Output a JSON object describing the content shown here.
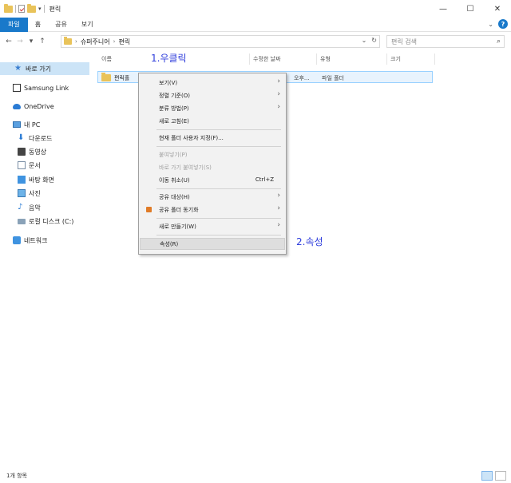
{
  "window": {
    "title": "편릭",
    "qa_dropdown": "▾",
    "controls": {
      "minimize": "—",
      "maximize": "☐",
      "close": "✕"
    }
  },
  "ribbon": {
    "tabs": [
      "파일",
      "홈",
      "공유",
      "보기"
    ],
    "expand_glyph": "⌄",
    "help_glyph": "?"
  },
  "nav": {
    "back": "←",
    "forward": "→",
    "recent": "▾",
    "up": "↑",
    "breadcrumb": [
      "슈퍼주니어",
      "편릭"
    ],
    "crumb_sep": "›",
    "dropdown": "⌄",
    "refresh": "↻",
    "search_placeholder": "편릭 검색",
    "search_glyph": "⌕"
  },
  "sidebar": {
    "items": [
      {
        "label": "바로 가기",
        "icon": "star-icon"
      },
      {
        "label": "Samsung Link",
        "icon": "samsung-link-icon"
      },
      {
        "label": "OneDrive",
        "icon": "cloud-icon"
      },
      {
        "label": "내 PC",
        "icon": "pc-icon"
      },
      {
        "label": "다운로드",
        "icon": "download-icon"
      },
      {
        "label": "동영상",
        "icon": "video-icon"
      },
      {
        "label": "문서",
        "icon": "document-icon"
      },
      {
        "label": "바탕 화면",
        "icon": "desktop-icon"
      },
      {
        "label": "사진",
        "icon": "picture-icon"
      },
      {
        "label": "음악",
        "icon": "music-icon"
      },
      {
        "label": "로컬 디스크 (C:)",
        "icon": "disk-icon"
      },
      {
        "label": "네트워크",
        "icon": "network-icon"
      }
    ]
  },
  "columns": [
    "이름",
    "수정한 날짜",
    "유형",
    "크기"
  ],
  "files": [
    {
      "name": "편릭홀",
      "date": "오후...",
      "type": "파일 폴더"
    }
  ],
  "annotations": {
    "step1": "1.우클릭",
    "step2": "2.속성"
  },
  "context_menu": {
    "items": [
      {
        "label": "보기(V)",
        "submenu": true
      },
      {
        "label": "정렬 기준(O)",
        "submenu": true
      },
      {
        "label": "분류 방법(P)",
        "submenu": true
      },
      {
        "label": "새로 고침(E)"
      },
      {
        "label": "현재 폴더 사용자 지정(F)..."
      },
      {
        "label": "붙여넣기(P)",
        "disabled": true
      },
      {
        "label": "바로 가기 붙여넣기(S)",
        "disabled": true
      },
      {
        "label": "이동 취소(U)",
        "shortcut": "Ctrl+Z"
      },
      {
        "label": "공유 대상(H)",
        "submenu": true
      },
      {
        "label": "공유 폴더 동기화",
        "submenu": true
      },
      {
        "label": "새로 만들기(W)",
        "submenu": true
      },
      {
        "label": "속성(R)",
        "highlighted": true
      }
    ],
    "submenu_glyph": "›"
  },
  "status": {
    "item_count": "1개 항목"
  },
  "colors": {
    "accent": "#1979ca",
    "selection": "#cce4f7",
    "annotation": "#2c3bdb"
  }
}
